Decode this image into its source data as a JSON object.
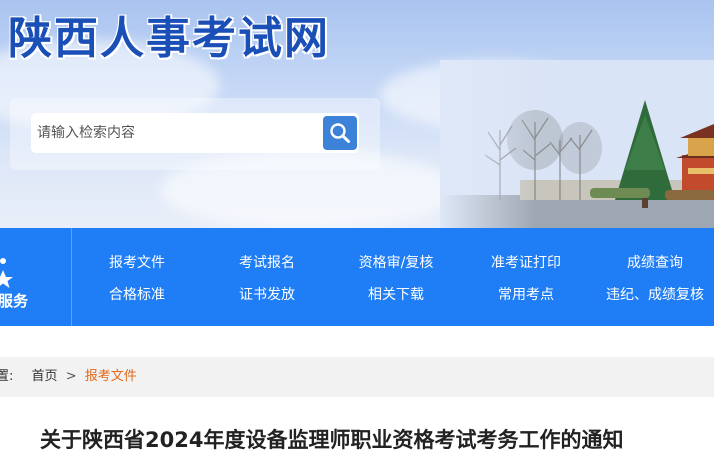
{
  "header": {
    "site_title": "陕西人事考试网",
    "search_placeholder": "请输入检索内容",
    "search_icon": "search-icon"
  },
  "nav": {
    "service_label": "服务",
    "row1": [
      "报考文件",
      "考试报名",
      "资格审/复核",
      "准考证打印",
      "成绩查询"
    ],
    "row2": [
      "合格标准",
      "证书发放",
      "相关下载",
      "常用考点",
      "违纪、成绩复核"
    ]
  },
  "breadcrumb": {
    "prefix": "置:",
    "home": "首页",
    "separator": ">",
    "current": "报考文件"
  },
  "article": {
    "title": "关于陕西省2024年度设备监理师职业资格考试考务工作的通知"
  },
  "colors": {
    "nav_blue": "#1f7ef5",
    "title_blue": "#1b4fb8",
    "crumb_orange": "#e26a1a"
  }
}
